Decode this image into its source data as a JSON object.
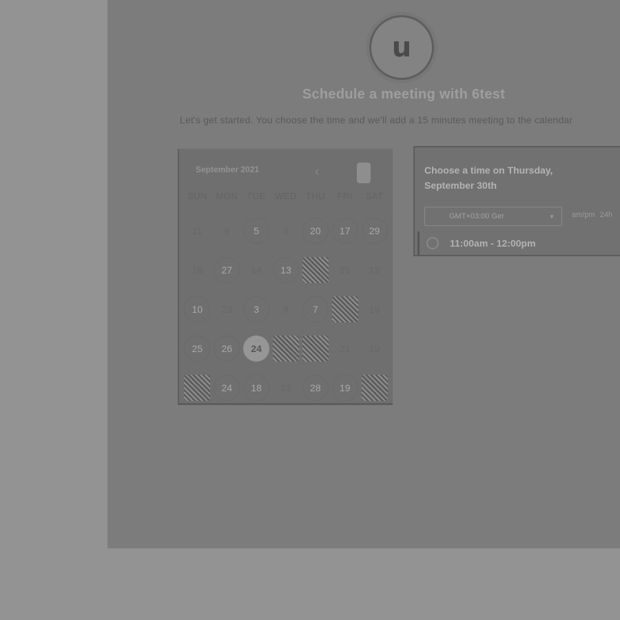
{
  "header": {
    "avatar_letter": "u",
    "title": "Schedule a meeting with 6test",
    "subtitle": "Let's get started. You choose the time and we'll add a 15 minutes meeting to the calendar"
  },
  "calendar": {
    "month_label": "September 2021",
    "prev_icon": "chevron-left-icon",
    "next_icon": "chevron-right-icon",
    "weekdays": [
      "SUN",
      "MON",
      "TUE",
      "WED",
      "THU",
      "FRI",
      "SAT"
    ],
    "days": [
      [
        "11",
        "9",
        "5",
        "5",
        "20",
        "17",
        "29"
      ],
      [
        "16",
        "27",
        "14",
        "13",
        "",
        "21",
        "12"
      ],
      [
        "10",
        "23",
        "3",
        "9",
        "7",
        "",
        "19"
      ],
      [
        "25",
        "26",
        "24",
        "",
        "",
        "21",
        "19"
      ],
      [
        "",
        "24",
        "18",
        "23",
        "28",
        "19",
        ""
      ]
    ],
    "selected_day": "24"
  },
  "time_panel": {
    "heading": "Choose a time on Thursday, September 30th",
    "timezone": "GMT+03:00 Ger",
    "format_options": [
      "am/pm",
      "24h"
    ],
    "slots": [
      "11:00am - 12:00pm"
    ]
  },
  "colors": {
    "background": "#939393",
    "page": "#7c7c7c",
    "card": "#6f6f6f"
  }
}
